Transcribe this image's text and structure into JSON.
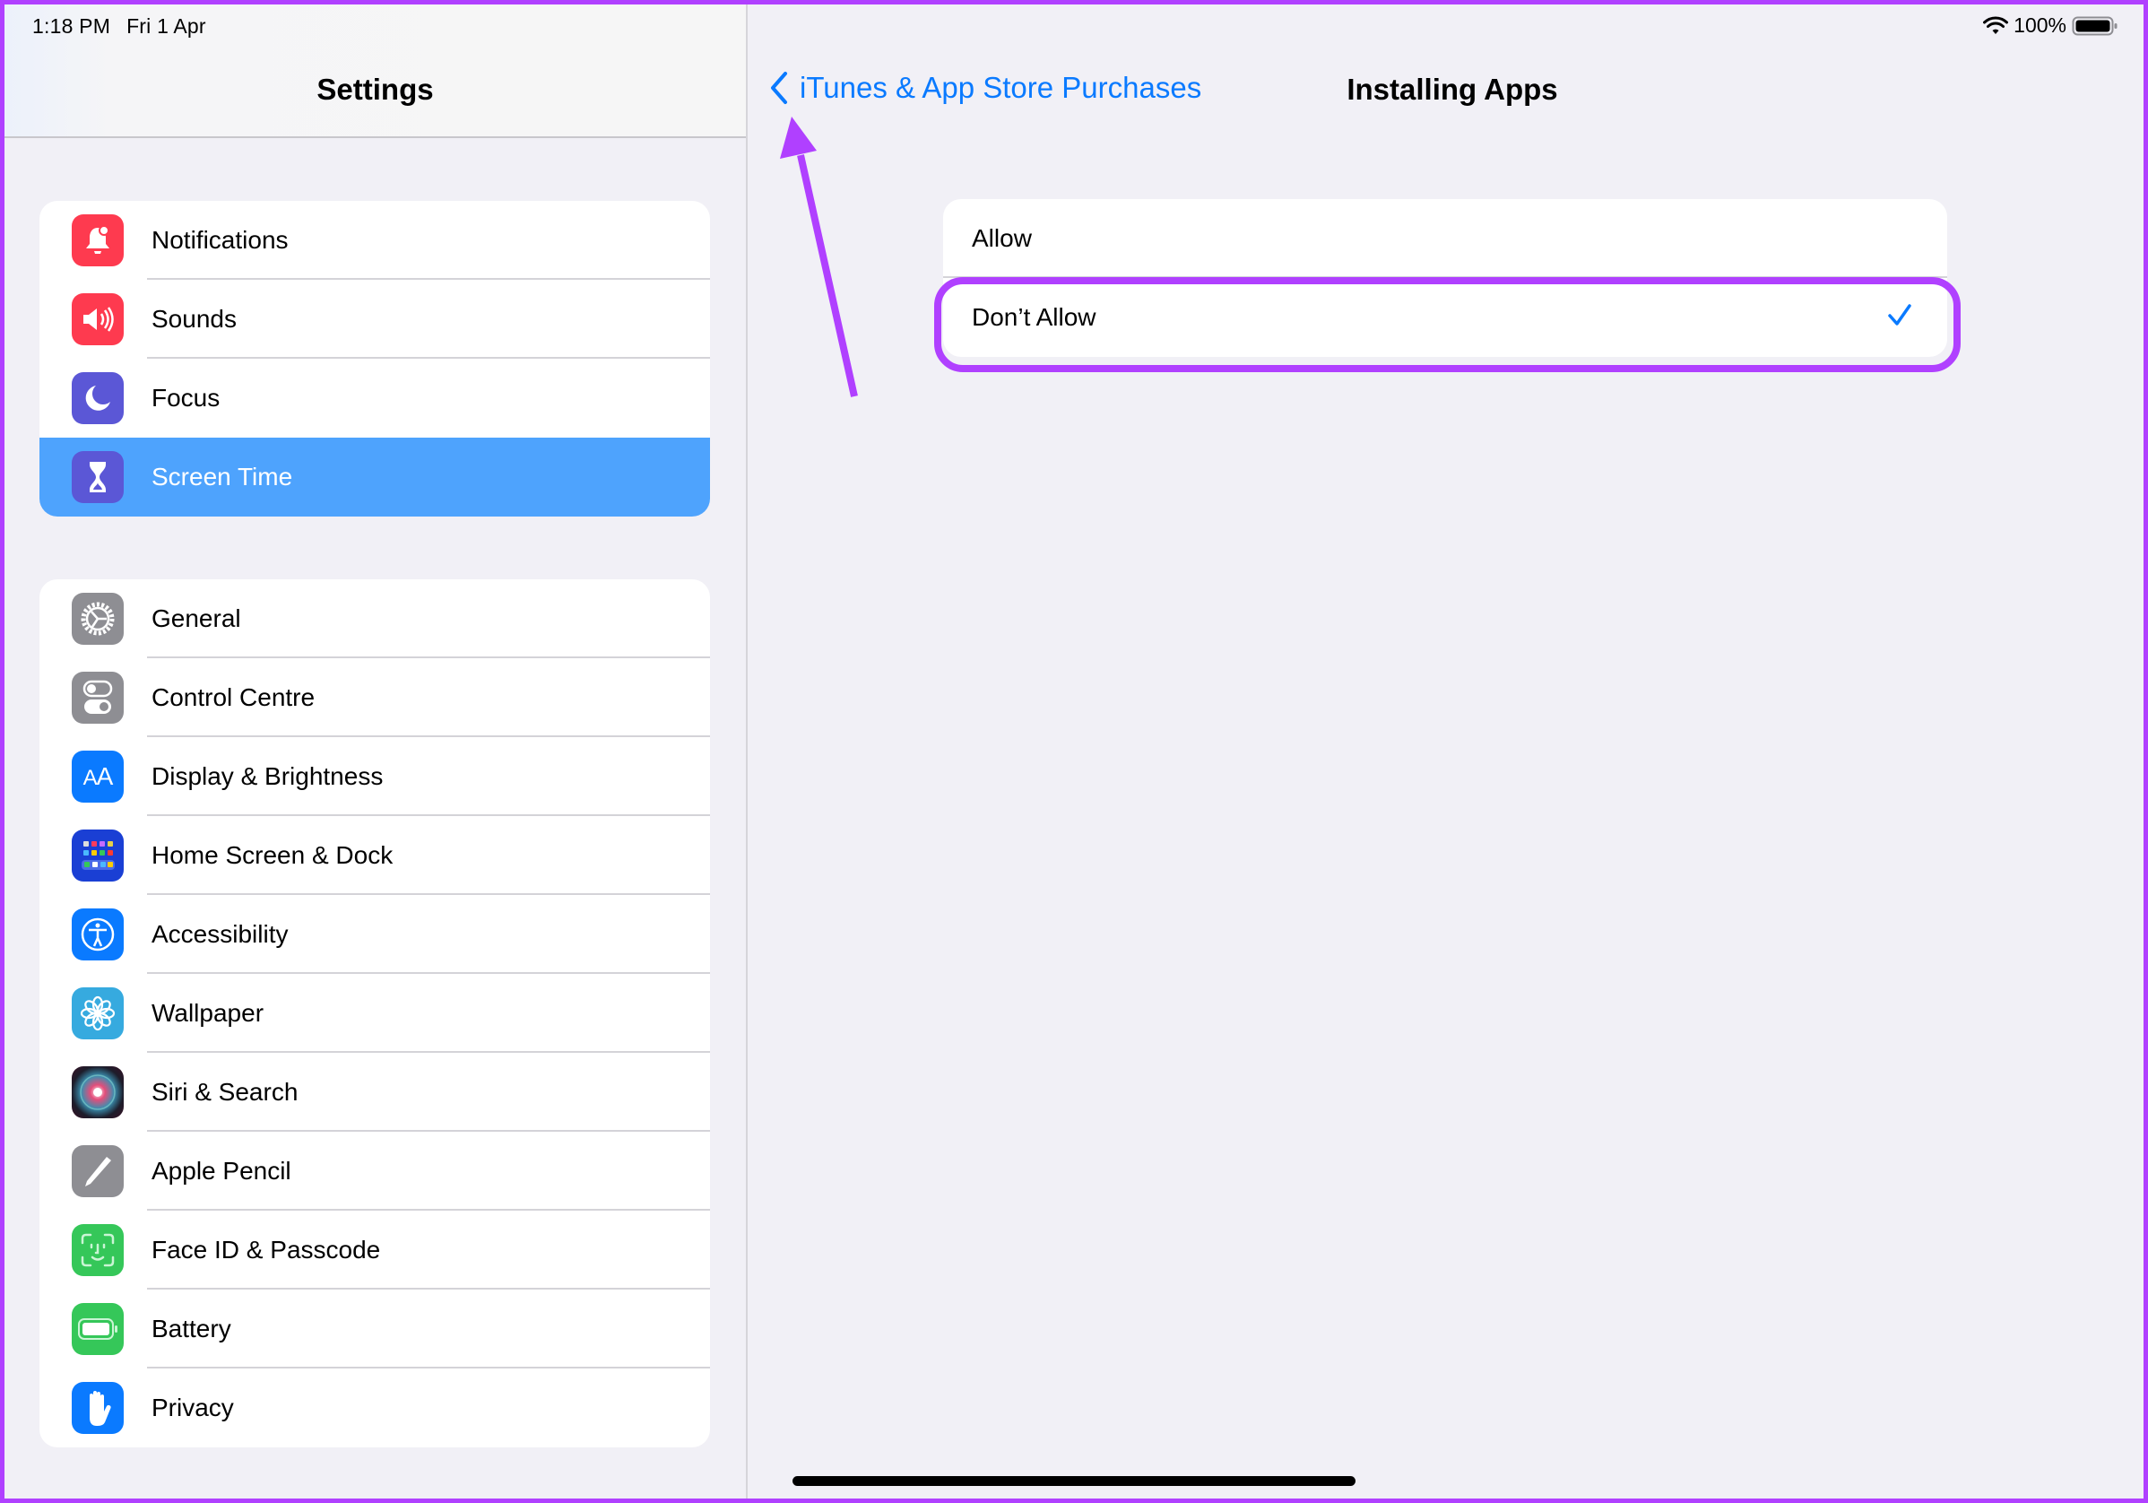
{
  "status_bar": {
    "time": "1:18 PM",
    "date": "Fri 1 Apr",
    "battery_percent": "100%",
    "wifi_icon": "wifi-icon",
    "battery_icon": "battery-full-icon"
  },
  "sidebar": {
    "title": "Settings",
    "groups": [
      {
        "items": [
          {
            "label": "Notifications",
            "icon": "bell-badge-icon",
            "color": "#fe3a4f"
          },
          {
            "label": "Sounds",
            "icon": "speaker-wave-icon",
            "color": "#fe3a4f"
          },
          {
            "label": "Focus",
            "icon": "moon-icon",
            "color": "#5b57d6"
          },
          {
            "label": "Screen Time",
            "icon": "hourglass-icon",
            "color": "#5b57d6",
            "selected": true
          }
        ]
      },
      {
        "items": [
          {
            "label": "General",
            "icon": "gear-icon",
            "color": "#8e8e93"
          },
          {
            "label": "Control Centre",
            "icon": "toggles-icon",
            "color": "#8e8e93"
          },
          {
            "label": "Display & Brightness",
            "icon": "text-size-icon",
            "color": "#0a7aff"
          },
          {
            "label": "Home Screen & Dock",
            "icon": "app-grid-icon",
            "color": "#1a3fd4"
          },
          {
            "label": "Accessibility",
            "icon": "accessibility-icon",
            "color": "#0a7aff"
          },
          {
            "label": "Wallpaper",
            "icon": "flower-icon",
            "color": "#36aadf"
          },
          {
            "label": "Siri & Search",
            "icon": "siri-icon",
            "color": "#2a1a2a"
          },
          {
            "label": "Apple Pencil",
            "icon": "pencil-icon",
            "color": "#8e8e93"
          },
          {
            "label": "Face ID & Passcode",
            "icon": "face-id-icon",
            "color": "#35c759"
          },
          {
            "label": "Battery",
            "icon": "battery-icon",
            "color": "#35c759"
          },
          {
            "label": "Privacy",
            "icon": "hand-icon",
            "color": "#0a7aff"
          }
        ]
      }
    ]
  },
  "detail": {
    "back_label": "iTunes & App Store Purchases",
    "title": "Installing Apps",
    "options": [
      {
        "label": "Allow",
        "checked": false
      },
      {
        "label": "Don’t Allow",
        "checked": true
      }
    ]
  },
  "colors": {
    "accent": "#0a7aff",
    "selection": "#4ea3fd",
    "annotation": "#b040ff"
  }
}
